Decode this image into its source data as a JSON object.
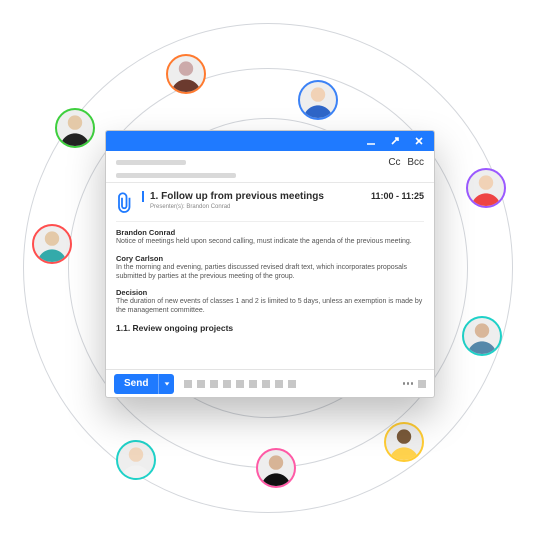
{
  "header": {
    "cc": "Cc",
    "bcc": "Bcc"
  },
  "agenda": {
    "title": "1. Follow up from previous meetings",
    "time": "11:00 - 11:25",
    "presenter_label": "Presenter(s): Brandon Conrad",
    "sections": [
      {
        "heading": "Brandon Conrad",
        "text": "Notice of meetings held upon second calling, must indicate the agenda of the previous meeting."
      },
      {
        "heading": "Cory Carlson",
        "text": "In the morning and evening, parties discussed revised draft text, which incorporates proposals submitted by parties at the previous meeting of the group."
      },
      {
        "heading": "Decision",
        "text": "The duration of new events of classes 1 and 2 is limited to 5 days, unless an exemption is made by the management committee."
      }
    ],
    "subheading": "1.1. Review ongoing projects"
  },
  "footer": {
    "send": "Send"
  }
}
